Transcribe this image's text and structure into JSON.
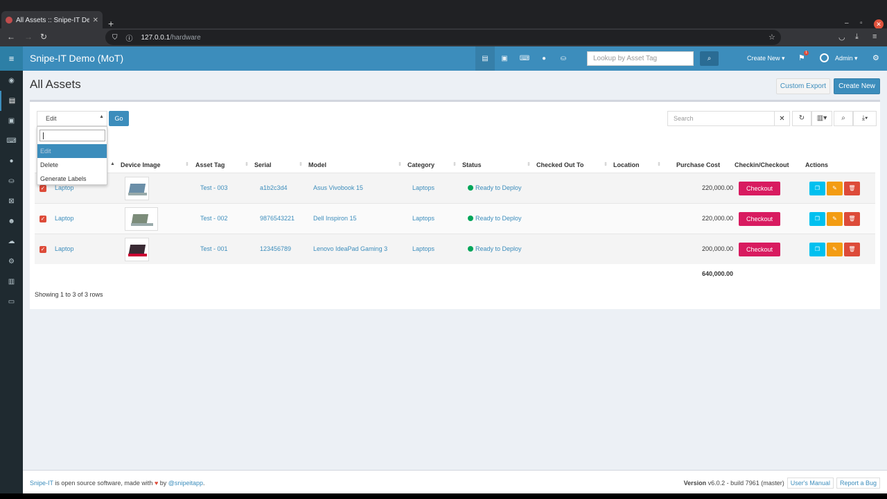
{
  "browser": {
    "tab_title": "All Assets :: Snipe-IT Dem",
    "url_domain": "127.0.0.1",
    "url_path": "/hardware"
  },
  "header": {
    "brand": "Snipe-IT Demo (MoT)",
    "lookup_placeholder": "Lookup by Asset Tag",
    "create_new": "Create New",
    "notification_count": "1",
    "user": "Admin"
  },
  "page": {
    "title": "All Assets",
    "custom_export": "Custom Export",
    "create_new": "Create New"
  },
  "bulk": {
    "selected": "Edit",
    "go": "Go",
    "options": [
      "Edit",
      "Delete",
      "Generate Labels"
    ]
  },
  "table": {
    "search_placeholder": "Search",
    "columns": [
      "Device Image",
      "Asset Tag",
      "Serial",
      "Model",
      "Category",
      "Status",
      "Checked Out To",
      "Location",
      "Purchase Cost",
      "Checkin/Checkout",
      "Actions"
    ],
    "rows": [
      {
        "name": "Laptop",
        "asset_tag": "Test - 003",
        "serial": "a1b2c3d4",
        "model": "Asus Vivobook 15",
        "category": "Laptops",
        "status": "Ready to Deploy",
        "cost": "220,000.00",
        "action": "Checkout"
      },
      {
        "name": "Laptop",
        "asset_tag": "Test - 002",
        "serial": "9876543221",
        "model": "Dell Inspiron 15",
        "category": "Laptops",
        "status": "Ready to Deploy",
        "cost": "220,000.00",
        "action": "Checkout"
      },
      {
        "name": "Laptop",
        "asset_tag": "Test - 001",
        "serial": "123456789",
        "model": "Lenovo IdeaPad Gaming 3",
        "category": "Laptops",
        "status": "Ready to Deploy",
        "cost": "200,000.00",
        "action": "Checkout"
      }
    ],
    "total": "640,000.00",
    "showing": "Showing 1 to 3 of 3 rows"
  },
  "footer": {
    "brand_link": "Snipe-IT",
    "text1": " is open source software, made with ",
    "text2": " by ",
    "author": "@snipeitapp",
    "dot": ".",
    "version_label": "Version",
    "version_value": "v6.0.2 - build 7961 (master)",
    "manual": "User's Manual",
    "bug": "Report a Bug"
  },
  "colors": {
    "header": "#3c8dbc",
    "sidebar": "#1f2a30",
    "checkout": "#d81b60",
    "status_green": "#00a65a"
  }
}
